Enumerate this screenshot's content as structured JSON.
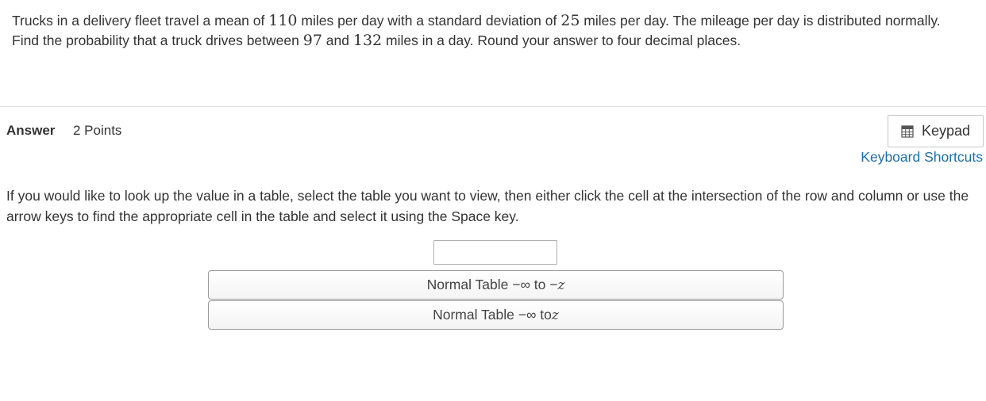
{
  "question": {
    "part1": "Trucks in a delivery fleet travel a mean of ",
    "mean": "110",
    "part2": " miles per day with a standard deviation of ",
    "sd": "25",
    "part3": " miles per day. The mileage per day is distributed normally. Find the probability that a truck drives between ",
    "low": "97",
    "part4": " and ",
    "high": "132",
    "part5": " miles in a day. Round your answer to four decimal places."
  },
  "answer": {
    "label": "Answer",
    "points": "2 Points",
    "keypad_label": "Keypad",
    "keypad_icon": "calculator-icon",
    "shortcuts_label": "Keyboard Shortcuts",
    "input_value": ""
  },
  "instructions": "If you would like to look up the value in a table, select the table you want to view, then either click the cell at the intersection of the row and column or use the arrow keys to find the appropriate cell in the table and select it using the Space key.",
  "tables": [
    {
      "prefix": "Normal Table −∞ to −",
      "var": "z"
    },
    {
      "prefix": "Normal Table −∞ to ",
      "var": "z"
    }
  ],
  "colors": {
    "link": "#1d6fa5",
    "text": "#333333",
    "divider": "#dddddd"
  }
}
